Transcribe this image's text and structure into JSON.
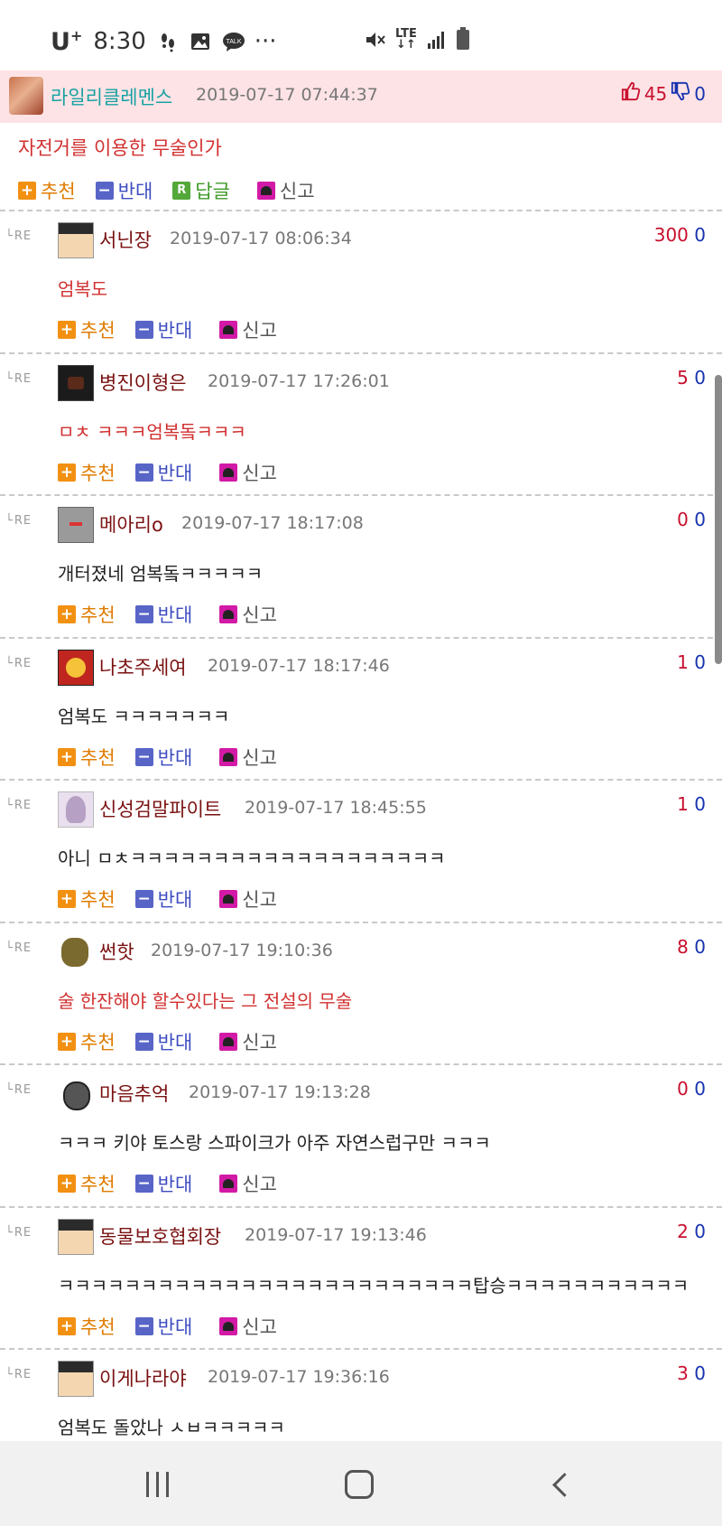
{
  "status_bar": {
    "carrier": "U",
    "carrier_sup": "+",
    "time": "8:30",
    "more": "···",
    "lte": "LTE",
    "icons": [
      "steps-icon",
      "gallery-icon",
      "talk-icon",
      "mute-icon",
      "signal-icon",
      "battery-icon"
    ]
  },
  "post": {
    "author": "라일리클레멘스",
    "time": "2019-07-17 07:44:37",
    "upvotes": "45",
    "downvotes": "0",
    "title": "자전거를 이용한 무술인가",
    "actions": {
      "recommend": "추천",
      "oppose": "반대",
      "reply": "답글",
      "report": "신고",
      "reply_badge": "R"
    }
  },
  "labels": {
    "re": "RE",
    "recommend": "추천",
    "oppose": "반대",
    "report": "신고"
  },
  "colors": {
    "vote_up": "#c8102e",
    "vote_down": "#1733b0",
    "author_main": "#17a2a2",
    "author": "#7a1010",
    "highlight_text": "#d23030",
    "post_bg": "#fde3e6"
  },
  "comments": [
    {
      "author": "서닌장",
      "time": "2019-07-17 08:06:34",
      "up": "300",
      "down": "0",
      "text": "엄복도",
      "highlight": true
    },
    {
      "author": "병진이형은",
      "time": "2019-07-17 17:26:01",
      "up": "5",
      "down": "0",
      "text": "ㅁㅊ ㅋㅋㅋ엄복돜ㅋㅋㅋ",
      "highlight": true
    },
    {
      "author": "메아리o",
      "time": "2019-07-17 18:17:08",
      "up": "0",
      "down": "0",
      "text": "개터졌네 엄복돜ㅋㅋㅋㅋㅋ",
      "highlight": false
    },
    {
      "author": "나초주세여",
      "time": "2019-07-17 18:17:46",
      "up": "1",
      "down": "0",
      "text": "엄복도 ㅋㅋㅋㅋㅋㅋㅋ",
      "highlight": false
    },
    {
      "author": "신성검말파이트",
      "time": "2019-07-17 18:45:55",
      "up": "1",
      "down": "0",
      "text": "아니 ㅁㅊㅋㅋㅋㅋㅋㅋㅋㅋㅋㅋㅋㅋㅋㅋㅋㅋㅋㅋㅋ",
      "highlight": false
    },
    {
      "author": "썬핫",
      "time": "2019-07-17 19:10:36",
      "up": "8",
      "down": "0",
      "text": "술 한잔해야 할수있다는 그 전설의 무술",
      "highlight": true
    },
    {
      "author": "마음추억",
      "time": "2019-07-17 19:13:28",
      "up": "0",
      "down": "0",
      "text": "ㅋㅋㅋ 키야 토스랑 스파이크가 아주 자연스럽구만 ㅋㅋㅋ",
      "highlight": false
    },
    {
      "author": "동물보호협회장",
      "time": "2019-07-17 19:13:46",
      "up": "2",
      "down": "0",
      "text": "ㅋㅋㅋㅋㅋㅋㅋㅋㅋㅋㅋㅋㅋㅋㅋㅋㅋㅋㅋㅋㅋㅋㅋㅋㅋ탑승ㅋㅋㅋㅋㅋㅋㅋㅋㅋㅋㅋ",
      "highlight": false
    },
    {
      "author": "이게나라야",
      "time": "2019-07-17 19:36:16",
      "up": "3",
      "down": "0",
      "text": "엄복도 돌았나 ㅅㅂㅋㅋㅋㅋㅋ",
      "highlight": false
    }
  ]
}
